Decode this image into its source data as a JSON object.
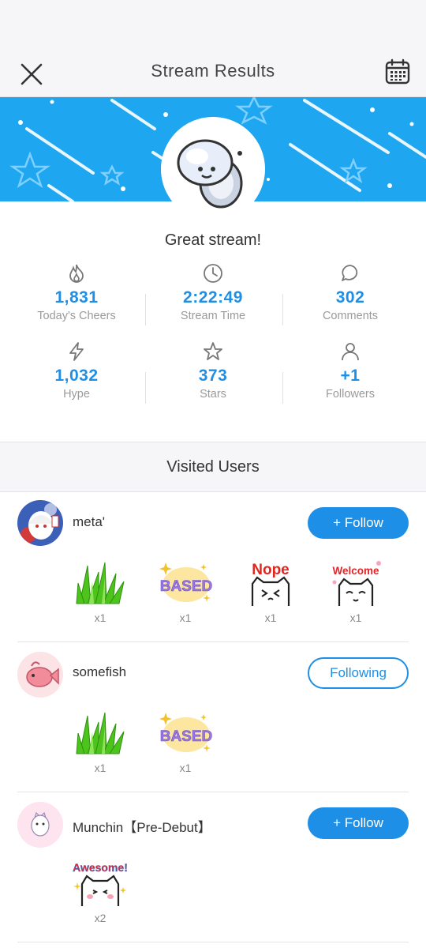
{
  "header": {
    "title": "Stream Results",
    "close_icon": "close-icon",
    "calendar_icon": "calendar-icon"
  },
  "summary": {
    "message": "Great stream!"
  },
  "stats": [
    {
      "icon": "flame-icon",
      "value": "1,831",
      "label": "Today's Cheers"
    },
    {
      "icon": "clock-icon",
      "value": "2:22:49",
      "label": "Stream Time"
    },
    {
      "icon": "comment-icon",
      "value": "302",
      "label": "Comments"
    },
    {
      "icon": "bolt-icon",
      "value": "1,032",
      "label": "Hype"
    },
    {
      "icon": "star-icon",
      "value": "373",
      "label": "Stars"
    },
    {
      "icon": "person-icon",
      "value": "+1",
      "label": "Followers"
    }
  ],
  "visited": {
    "title": "Visited Users",
    "users": [
      {
        "name": "meta'",
        "button": "+ Follow",
        "button_state": "follow",
        "stickers": [
          {
            "icon": "grass-sticker",
            "count": "x1"
          },
          {
            "icon": "based-sticker",
            "text": "BASED",
            "count": "x1"
          },
          {
            "icon": "nope-cat-sticker",
            "text": "Nope",
            "count": "x1"
          },
          {
            "icon": "welcome-cat-sticker",
            "text": "Welcome",
            "count": "x1"
          }
        ]
      },
      {
        "name": "somefish",
        "button": "Following",
        "button_state": "following",
        "stickers": [
          {
            "icon": "grass-sticker",
            "count": "x1"
          },
          {
            "icon": "based-sticker",
            "text": "BASED",
            "count": "x1"
          }
        ]
      },
      {
        "name": "Munchin【Pre-Debut】",
        "button": "+ Follow",
        "button_state": "follow",
        "stickers": [
          {
            "icon": "awesome-cat-sticker",
            "text": "Awesome!",
            "count": "x2"
          }
        ]
      }
    ]
  },
  "colors": {
    "accent": "#1e8fe6",
    "banner": "#1ea6f0",
    "muted": "#9a9a9a"
  }
}
